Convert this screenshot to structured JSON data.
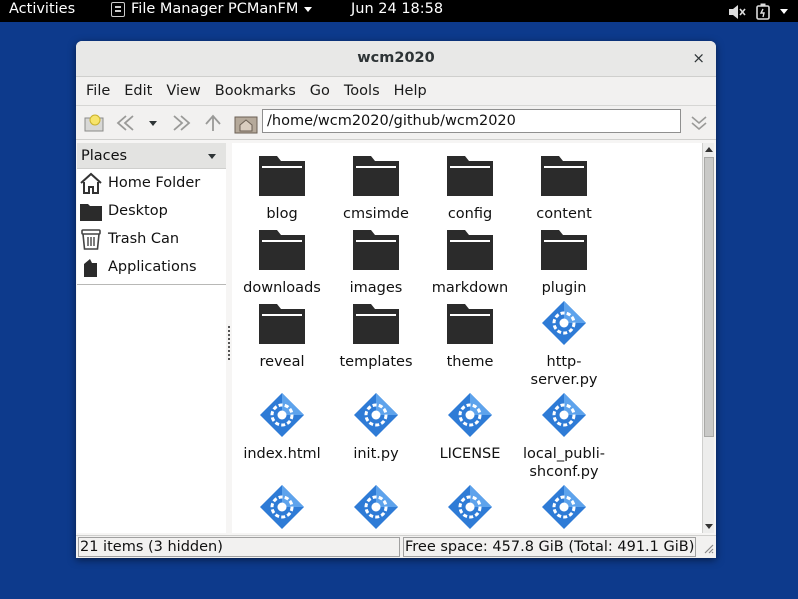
{
  "topbar": {
    "activities": "Activities",
    "app_name": "File Manager PCManFM",
    "clock": "Jun 24  18:58"
  },
  "window": {
    "title": "wcm2020",
    "close_glyph": "×"
  },
  "menu": {
    "file": "File",
    "edit": "Edit",
    "view": "View",
    "bookmarks": "Bookmarks",
    "go": "Go",
    "tools": "Tools",
    "help": "Help"
  },
  "toolbar": {
    "path": "/home/wcm2020/github/wcm2020"
  },
  "sidebar": {
    "header": "Places",
    "items": [
      {
        "label": "Home Folder",
        "icon": "home-icon"
      },
      {
        "label": "Desktop",
        "icon": "folder-icon"
      },
      {
        "label": "Trash Can",
        "icon": "trash-icon"
      },
      {
        "label": "Applications",
        "icon": "applications-icon"
      }
    ]
  },
  "files": [
    {
      "name": "blog",
      "type": "folder"
    },
    {
      "name": "cmsimde",
      "type": "folder"
    },
    {
      "name": "config",
      "type": "folder"
    },
    {
      "name": "content",
      "type": "folder"
    },
    {
      "name": "downloads",
      "type": "folder"
    },
    {
      "name": "images",
      "type": "folder"
    },
    {
      "name": "markdown",
      "type": "folder"
    },
    {
      "name": "plugin",
      "type": "folder"
    },
    {
      "name": "reveal",
      "type": "folder"
    },
    {
      "name": "templates",
      "type": "folder"
    },
    {
      "name": "theme",
      "type": "folder"
    },
    {
      "name": "http-\nserver.py",
      "type": "file"
    },
    {
      "name": "index.html",
      "type": "file"
    },
    {
      "name": "init.py",
      "type": "file"
    },
    {
      "name": "LICENSE",
      "type": "file"
    },
    {
      "name": "local_publi-\nshconf.py",
      "type": "file"
    },
    {
      "name": "",
      "type": "file"
    },
    {
      "name": "",
      "type": "file"
    },
    {
      "name": "",
      "type": "file"
    },
    {
      "name": "",
      "type": "file"
    }
  ],
  "status": {
    "items": "21 items (3 hidden)",
    "free_space": "Free space: 457.8 GiB (Total: 491.1 GiB)"
  },
  "colors": {
    "desktop": "#0d3a8c",
    "folder": "#2b2b2b",
    "file_icon": "#2e7bd6"
  }
}
